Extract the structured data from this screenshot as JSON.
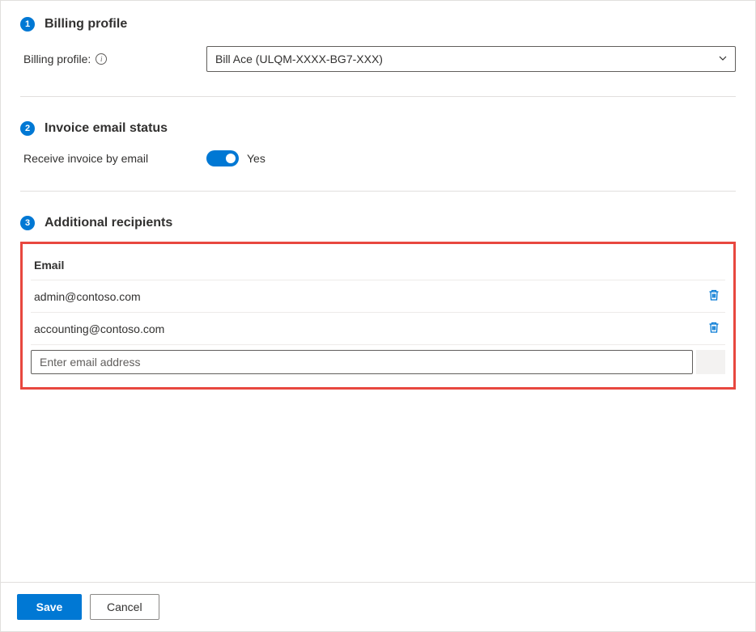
{
  "section1": {
    "step": "1",
    "title": "Billing profile",
    "label": "Billing profile:",
    "selected": "Bill Ace (ULQM-XXXX-BG7-XXX)"
  },
  "section2": {
    "step": "2",
    "title": "Invoice email status",
    "label": "Receive invoice by email",
    "toggle_on": true,
    "toggle_state_label": "Yes"
  },
  "section3": {
    "step": "3",
    "title": "Additional recipients",
    "column_header": "Email",
    "recipients": [
      "admin@contoso.com",
      "accounting@contoso.com"
    ],
    "input_placeholder": "Enter email address"
  },
  "footer": {
    "save": "Save",
    "cancel": "Cancel"
  }
}
